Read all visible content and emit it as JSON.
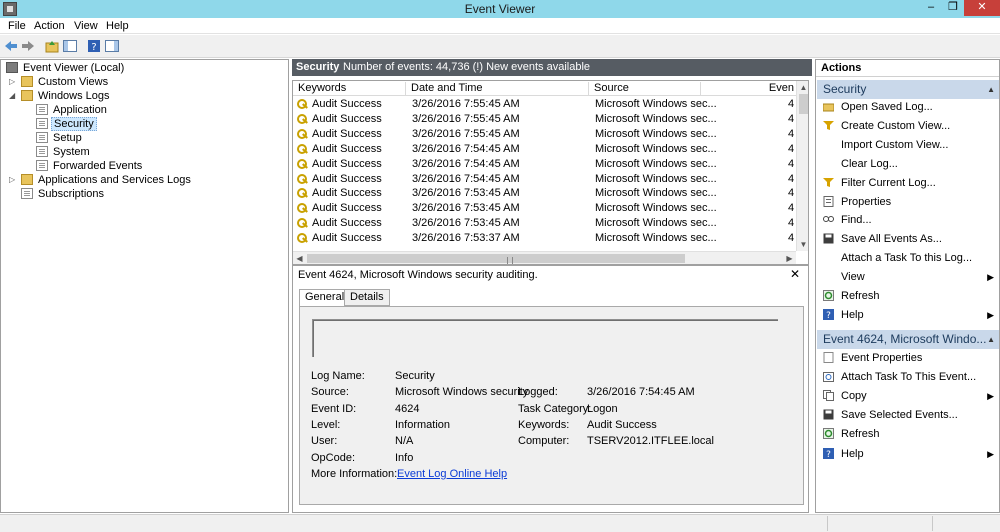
{
  "window": {
    "title": "Event Viewer",
    "min": "–",
    "max": "❐",
    "close": "✕"
  },
  "menu": [
    "File",
    "Action",
    "View",
    "Help"
  ],
  "tree": {
    "root": "Event Viewer (Local)",
    "custom_views": "Custom Views",
    "windows_logs": "Windows Logs",
    "application": "Application",
    "security": "Security",
    "setup": "Setup",
    "system": "System",
    "forwarded": "Forwarded Events",
    "apps_services": "Applications and Services Logs",
    "subscriptions": "Subscriptions"
  },
  "log_header": {
    "name": "Security",
    "count": "Number of events: 44,736 (!) New events available"
  },
  "grid": {
    "columns": [
      "Keywords",
      "Date and Time",
      "Source",
      "Even"
    ],
    "rows": [
      {
        "kw": "Audit Success",
        "dt": "3/26/2016 7:55:45 AM",
        "src": "Microsoft Windows sec...",
        "id": "4"
      },
      {
        "kw": "Audit Success",
        "dt": "3/26/2016 7:55:45 AM",
        "src": "Microsoft Windows sec...",
        "id": "4"
      },
      {
        "kw": "Audit Success",
        "dt": "3/26/2016 7:55:45 AM",
        "src": "Microsoft Windows sec...",
        "id": "4"
      },
      {
        "kw": "Audit Success",
        "dt": "3/26/2016 7:54:45 AM",
        "src": "Microsoft Windows sec...",
        "id": "4"
      },
      {
        "kw": "Audit Success",
        "dt": "3/26/2016 7:54:45 AM",
        "src": "Microsoft Windows sec...",
        "id": "4"
      },
      {
        "kw": "Audit Success",
        "dt": "3/26/2016 7:54:45 AM",
        "src": "Microsoft Windows sec...",
        "id": "4"
      },
      {
        "kw": "Audit Success",
        "dt": "3/26/2016 7:53:45 AM",
        "src": "Microsoft Windows sec...",
        "id": "4"
      },
      {
        "kw": "Audit Success",
        "dt": "3/26/2016 7:53:45 AM",
        "src": "Microsoft Windows sec...",
        "id": "4"
      },
      {
        "kw": "Audit Success",
        "dt": "3/26/2016 7:53:45 AM",
        "src": "Microsoft Windows sec...",
        "id": "4"
      },
      {
        "kw": "Audit Success",
        "dt": "3/26/2016 7:53:37 AM",
        "src": "Microsoft Windows sec...",
        "id": "4"
      }
    ]
  },
  "detail": {
    "title": "Event 4624, Microsoft Windows security auditing.",
    "close": "✕",
    "tabs": [
      "General",
      "Details"
    ],
    "labels": {
      "log_name": "Log Name:",
      "source": "Source:",
      "event_id": "Event ID:",
      "level": "Level:",
      "user": "User:",
      "opcode": "OpCode:",
      "more_info": "More Information:",
      "logged": "Logged:",
      "task_category": "Task Category:",
      "keywords": "Keywords:",
      "computer": "Computer:"
    },
    "values": {
      "log_name": "Security",
      "source": "Microsoft Windows security",
      "event_id": "4624",
      "level": "Information",
      "user": "N/A",
      "opcode": "Info",
      "more_info": "Event Log Online Help",
      "logged": "3/26/2016 7:54:45 AM",
      "task_category": "Logon",
      "keywords": "Audit Success",
      "computer": "TSERV2012.ITFLEE.local"
    }
  },
  "actions": {
    "title": "Actions",
    "security_header": "Security",
    "security_items": [
      "Open Saved Log...",
      "Create Custom View...",
      "Import Custom View...",
      "Clear Log...",
      "Filter Current Log...",
      "Properties",
      "Find...",
      "Save All Events As...",
      "Attach a Task To this Log...",
      "View",
      "Refresh",
      "Help"
    ],
    "event_header": "Event 4624, Microsoft Windo...",
    "event_items": [
      "Event Properties",
      "Attach Task To This Event...",
      "Copy",
      "Save Selected Events...",
      "Refresh",
      "Help"
    ]
  }
}
